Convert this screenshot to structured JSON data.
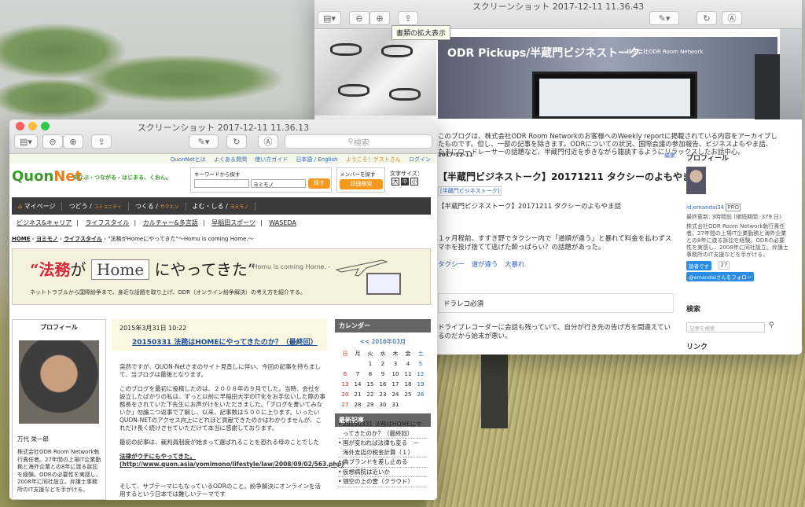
{
  "back_window": {
    "title": "スクリーンショット 2017-12-11 11.36.43",
    "tooltip": "書類の拡大表示",
    "banner_title": "ODR Pickups/半蔵門ビジネストーク",
    "banner_subtitle": "株式会社ODR Room Network",
    "intro": "このブログは、株式会社ODR Room Networkのお客様へのWeekly reportに掲載されている内容をアーカイブしたものです。但し、一部の記事を除きます。ODRについての状況、国際会議の参加報告、ビジネスよもやま話、たまにロードレーサーの話題など、半蔵門付近を歩きながら雑談するようにリラックスしたお話中心。",
    "date": "2017-12-11",
    "edit": "編集",
    "article_title": "【半蔵門ビジネストーク】20171211 タクシーのよもやま話",
    "category": "[半蔵門ビジネストーク]",
    "p1": "【半蔵門ビジネストーク】20171211 タクシーのよもやま話",
    "p2": "１ヶ月程前、すすき野でタクシー内で「道順が違う」と暴れて料金を払わずスマホを投げ捨てて逃げた酔っぱらい？の話題があった。",
    "tags": "タクシー　道が違う　大暴れ",
    "box": "ドラレコ必須",
    "p3": "ドライブレコーダーに会話も残っていて、自分が行き先の告げ方を間違えているのだから始末が悪い。",
    "sb_profile": "プロフィール",
    "sb_user": "id:emandai34",
    "sb_pro": "PRO",
    "sb_stats": "最終更新: 3時間前 (継続期間: 379 日)",
    "sb_desc": "株式会社ODR Room Network執行責任者。27年間の上場IT企業勤務と海外企業との8年に渡る訴訟を経験。ODRの必要性を実感し、2008年に同社設立。弁護士事務所のIT支援などを手がける。",
    "sb_reader": "読者です",
    "sb_count": "27",
    "sb_follow": "@emandaiさんをフォロー",
    "sb_search": "検索",
    "sb_search_ph": "記事を検索",
    "sb_link": "リンク"
  },
  "front_window": {
    "title": "スクリーンショット 2017-12-11 11.36.13",
    "search_placeholder": "検索",
    "topbar": [
      "QuonNetとは",
      "よくある質問",
      "使い方ガイド",
      "日本語 / English",
      "ようこそ！ゲストさん",
      "ログイン"
    ],
    "logo_a": "Quon",
    "logo_b": "Net",
    "logo_kana": "クオンネット",
    "tagline": "まなぶ・つながる・はじまる、くおん。",
    "kw_label": "キーワードから探す",
    "kw_select": "ヨミモノ",
    "kw_btn": "探す",
    "mem_label": "メンバーを探す",
    "mem_btn": "詳細検索",
    "fs_label": "文字サイズ：",
    "fs": [
      "大",
      "中",
      "小"
    ],
    "nav": [
      {
        "l": "マイページ",
        "s": ""
      },
      {
        "l": "つどう",
        "s": "コミュニティ"
      },
      {
        "l": "つくる",
        "s": "サクヒン"
      },
      {
        "l": "よむ・しる",
        "s": "ヨミモノ"
      }
    ],
    "subnav": [
      "ビジネス&キャリア",
      "ライフスタイル",
      "カルチャー&多言語",
      "早稲田スポーツ",
      "WASEDA"
    ],
    "breadcrumb": [
      "HOME",
      "ヨミモノ",
      "ライフスタイル",
      "\"法務がHomeにやってきた\"～Homu is coming Home.～"
    ],
    "hero_a": "“法務",
    "hero_b": "が",
    "hero_c": "Home",
    "hero_d": "にやってきた”",
    "hero_sub": "- Homu is coming Home. -",
    "hero_desc": "ネットトラブルから国際紛争まで、身近な話題を取り上げ、ODR（オンライン紛争解決）の考え方を紹介する。",
    "profile_h": "プロフィール",
    "profile_name": "万代 栄一郎",
    "profile_desc": "株式会社ODR Room Network執行責任者。27年間の上場IT企業勤務と海外企業との8年に渡る訴訟を経験。ODRの必要性を実感し、2008年に同社設立。弁護士事務所のIT支援などを手がける。",
    "post_date": "2015年3月31日 10:22",
    "post_title": "20150331 法務はHOMEにやってきたのか？（最終回）",
    "post_p1": "突然ですが、QUON-Netさまのサイト見直しに伴い、今回の記事を持ちまして、当ブログは最後となります。",
    "post_p2": "このブログを最初に投稿したのは、２００８年の９月でした。当時、会社を設立したばかりの私は、ずっと以前に早稲田大学のIT化をお手伝いした際の事務長をされていた下先生にお声がけをいただきました。「ブログを書いてみないか」勿論二つ返事で了解し、以来、記事数は５００に上ります。いったいQUON-NETのアクセス向上にどれほど貢献できたのかはわかりませんが、これだけ長く続けさせていただけて本当に感謝しております。",
    "post_p3": "最初の記事は、裁判員制度が始まって選ばれることを恐れる母のことでした",
    "post_link_t": "法律がウチにもやってきた。",
    "post_link": "(http://www.quon.asia/yomimono/lifestyle/law/2008/09/02/563.php)",
    "post_p4": "そして、サブテーマにもなっているODRのこと。紛争解決にオンラインを活用するという日本では難しいテーマです",
    "cal_h": "カレンダー",
    "cal_month": "<< 2016年03月",
    "cal_days": [
      "日",
      "月",
      "火",
      "水",
      "木",
      "金",
      "土"
    ],
    "cal_rows": [
      [
        "",
        "",
        "1",
        "2",
        "3",
        "4",
        "5"
      ],
      [
        "6",
        "7",
        "8",
        "9",
        "10",
        "11",
        "12"
      ],
      [
        "13",
        "14",
        "15",
        "16",
        "17",
        "18",
        "19"
      ],
      [
        "20",
        "21",
        "22",
        "23",
        "24",
        "25",
        "26"
      ],
      [
        "27",
        "28",
        "29",
        "30",
        "31",
        "",
        ""
      ]
    ],
    "recent_h": "最新記事",
    "recent": [
      "20150331 法務はHOMEにやってきたのか？（最終回）",
      "国が変われば法律も変る　－　海外支店の税金計算（１）",
      "偽ブランドを差し止める",
      "仮想病院は近いか",
      "領空の上の雲（クラウド）"
    ]
  }
}
